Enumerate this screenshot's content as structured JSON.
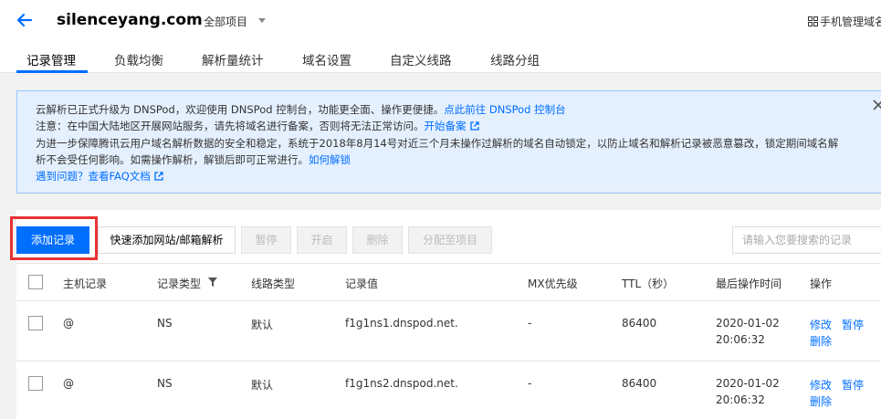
{
  "header": {
    "domain": "silenceyang.com",
    "project": "全部项目",
    "mobile": "手机管理域名"
  },
  "tabs": [
    "记录管理",
    "负载均衡",
    "解析量统计",
    "域名设置",
    "自定义线路",
    "线路分组"
  ],
  "notice": {
    "line1_text": "云解析已正式升级为 DNSPod，欢迎使用 DNSPod 控制台，功能更全面、操作更便捷。",
    "line1_link": "点此前往 DNSPod 控制台",
    "line2_text": "注意：在中国大陆地区开展网站服务，请先将域名进行备案，否则将无法正常访问。",
    "line2_link": "开始备案",
    "line3_text": "为进一步保障腾讯云用户域名解析数据的安全和稳定，系统于2018年8月14号对近三个月未操作过解析的域名自动锁定，以防止域名和解析记录被恶意篡改，锁定期间域名解",
    "line4_text": "析不会受任何影响。如需操作解析，解锁后即可正常进行。",
    "line4_link": "如何解锁",
    "line5_link": "遇到问题？查看FAQ文档"
  },
  "toolbar": {
    "add": "添加记录",
    "quick_add": "快速添加网站/邮箱解析",
    "pause": "暂停",
    "enable": "开启",
    "delete": "删除",
    "assign": "分配至项目",
    "search_placeholder": "请输入您要搜索的记录"
  },
  "table": {
    "headers": [
      "主机记录",
      "记录类型",
      "线路类型",
      "记录值",
      "MX优先级",
      "TTL（秒）",
      "最后操作时间",
      "操作"
    ],
    "rows": [
      {
        "host": "@",
        "type": "NS",
        "line": "默认",
        "value": "f1g1ns1.dnspod.net.",
        "mx": "-",
        "ttl": "86400",
        "date": "2020-01-02",
        "time": "20:06:32",
        "edit": "修改",
        "pause": "暂停",
        "del": "删除"
      },
      {
        "host": "@",
        "type": "NS",
        "line": "默认",
        "value": "f1g1ns2.dnspod.net.",
        "mx": "-",
        "ttl": "86400",
        "date": "2020-01-02",
        "time": "20:06:32",
        "edit": "修改",
        "pause": "暂停",
        "del": "删除"
      }
    ]
  },
  "colors": {
    "accent": "#006eff",
    "highlight": "#e83232",
    "notice_bg": "#e5f0ff"
  }
}
